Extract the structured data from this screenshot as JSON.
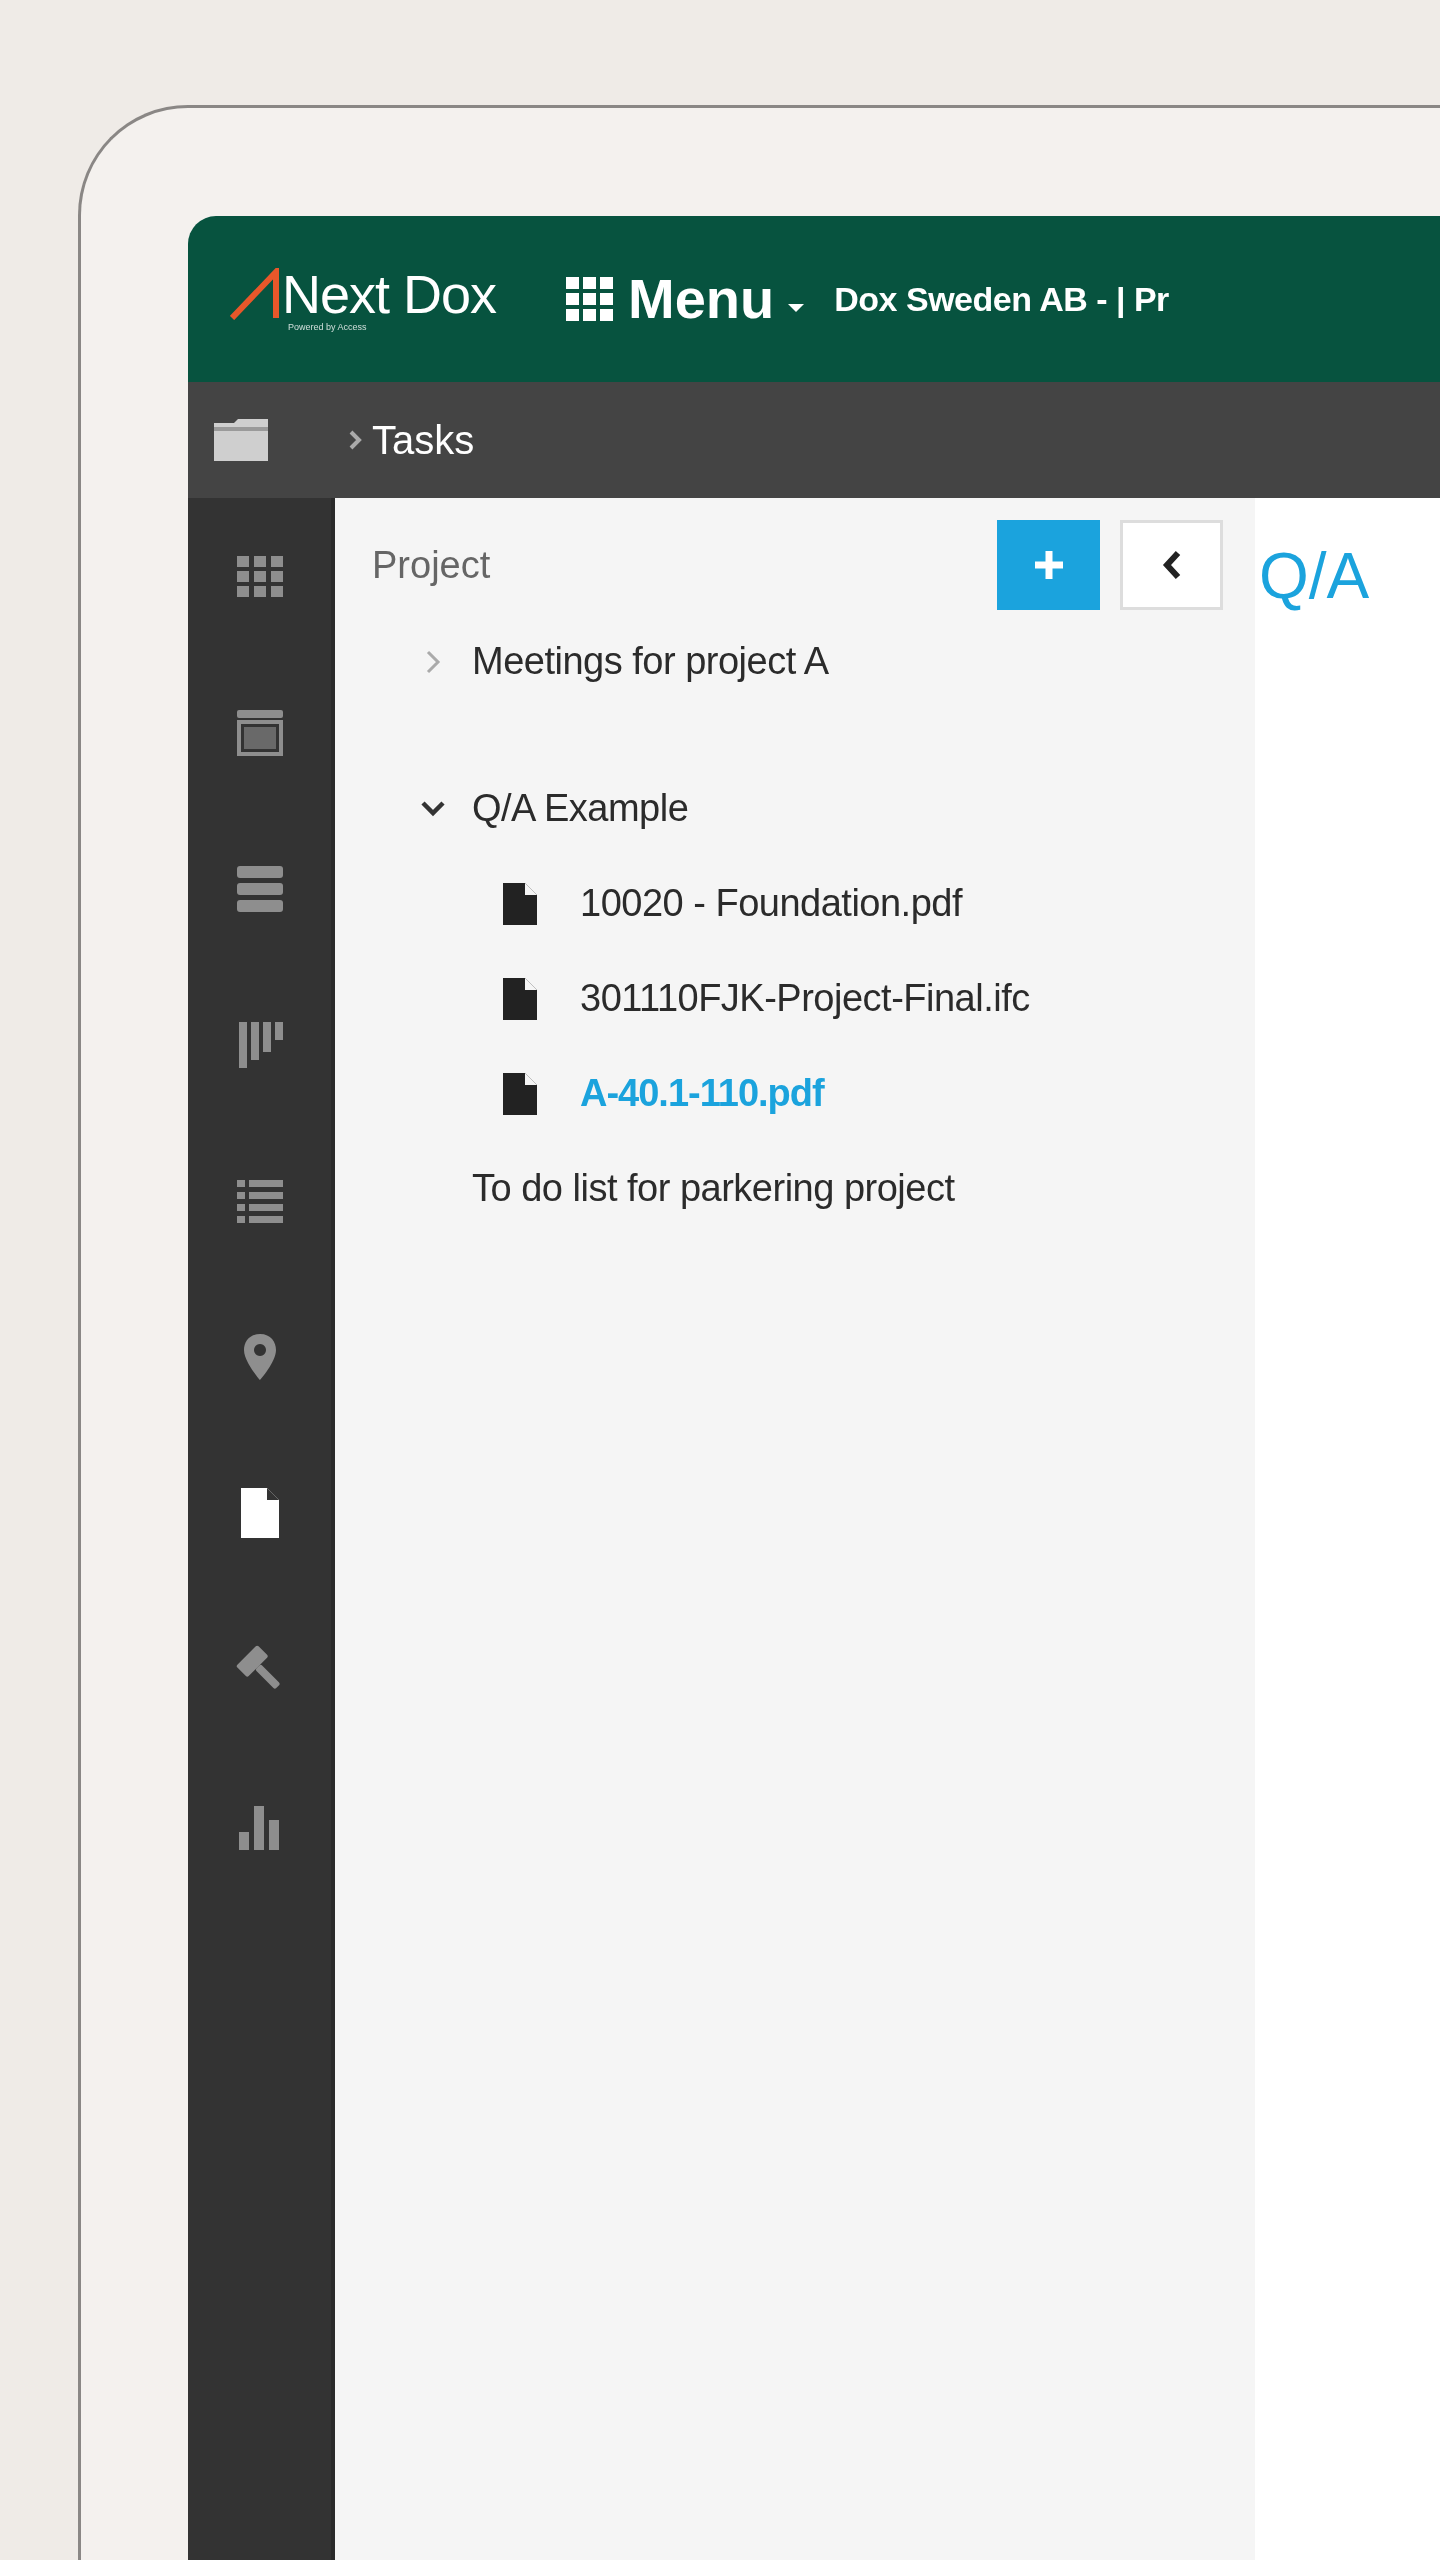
{
  "header": {
    "logo": {
      "name": "Next Dox",
      "tagline": "Powered by Access"
    },
    "menu": "Menu",
    "company": "Dox Sweden AB - | Pr"
  },
  "breadcrumb": {
    "items": [
      "Tasks"
    ]
  },
  "rail": [
    {
      "kind": "grid",
      "selected": false
    },
    {
      "kind": "calendar",
      "selected": false
    },
    {
      "kind": "stack",
      "selected": false
    },
    {
      "kind": "columns",
      "selected": false
    },
    {
      "kind": "list",
      "selected": false
    },
    {
      "kind": "pin",
      "selected": false
    },
    {
      "kind": "document",
      "selected": true
    },
    {
      "kind": "gavel",
      "selected": false
    },
    {
      "kind": "chart",
      "selected": false
    }
  ],
  "panel": {
    "title": "Project",
    "tree": [
      {
        "kind": "folder",
        "label": "Meetings for project A",
        "expanded": false,
        "selected": false
      },
      {
        "kind": "folder",
        "label": "Q/A Example",
        "expanded": true,
        "selected": false,
        "children": [
          {
            "kind": "file",
            "label": "10020 - Foundation.pdf",
            "selected": false
          },
          {
            "kind": "file",
            "label": "301110FJK-Project-Final.ifc",
            "selected": false
          },
          {
            "kind": "file",
            "label": "A-40.1-110.pdf",
            "selected": true
          }
        ]
      },
      {
        "kind": "item",
        "label": "To do list for parkering project",
        "selected": false
      }
    ]
  },
  "main": {
    "title": "Q/A"
  }
}
